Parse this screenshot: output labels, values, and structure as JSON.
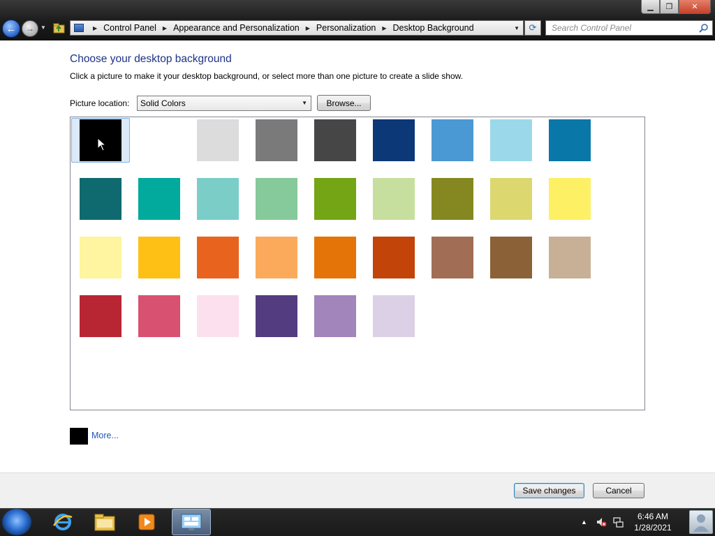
{
  "window": {
    "title_buttons": {
      "minimize": "▁",
      "maximize": "❐",
      "close": "✕"
    }
  },
  "nav": {
    "breadcrumbs": [
      "Control Panel",
      "Appearance and Personalization",
      "Personalization",
      "Desktop Background"
    ],
    "search_placeholder": "Search Control Panel"
  },
  "page": {
    "title": "Choose your desktop background",
    "subtitle": "Click a picture to make it your desktop background, or select more than one picture to create a slide show.",
    "location_label": "Picture location:",
    "location_value": "Solid Colors",
    "browse_label": "Browse...",
    "more_label": "More...",
    "selected_color": "#000000",
    "swatches": [
      "#000000",
      "#ffffff",
      "#dcdcdc",
      "#7a7a7a",
      "#464646",
      "#0d3878",
      "#4a98d4",
      "#9bd9ea",
      "#0a77a9",
      "#0f6a6f",
      "#02a99d",
      "#7bcdc8",
      "#86c99a",
      "#74a514",
      "#c7df9e",
      "#858820",
      "#dcd86f",
      "#fdf065",
      "#fff49f",
      "#fec014",
      "#e8641e",
      "#fbaa5b",
      "#e57408",
      "#c24408",
      "#a16d55",
      "#8b6237",
      "#c8b096",
      "#b82634",
      "#d95171",
      "#fde0ed",
      "#543c80",
      "#a285bb",
      "#dbd0e5"
    ]
  },
  "footer": {
    "save_label": "Save changes",
    "cancel_label": "Cancel"
  },
  "taskbar": {
    "time": "6:46 AM",
    "date": "1/28/2021",
    "apps": [
      "internet-explorer",
      "windows-explorer",
      "media-player",
      "control-panel"
    ]
  },
  "icons": [
    "back-arrow-icon",
    "forward-arrow-icon",
    "up-folder-icon",
    "control-panel-icon",
    "refresh-icon",
    "search-icon",
    "windows-start-icon",
    "speaker-muted-icon",
    "network-icon",
    "action-center-flag-icon",
    "user-icon"
  ]
}
